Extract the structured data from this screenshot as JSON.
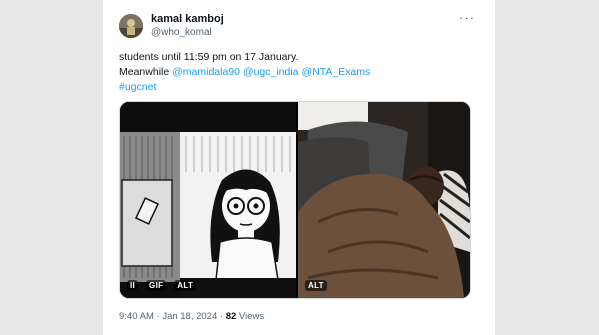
{
  "author": {
    "name": "kamal kamboj",
    "handle": "@who_komal"
  },
  "more_icon": "···",
  "tweet": {
    "line1": "students until 11:59 pm on 17 January.",
    "line2_prefix": "Meanwhile ",
    "mentions": [
      "@mamidala90",
      "@ugc_india",
      "@NTA_Exams"
    ],
    "hashtag": "#ugcnet"
  },
  "media": {
    "left": {
      "pause_icon": "II",
      "gif_label": "GIF",
      "alt_label": "ALT"
    },
    "right": {
      "alt_label": "ALT"
    }
  },
  "meta": {
    "time": "9:40 AM",
    "separator": "·",
    "date": "Jan 18, 2024",
    "views_count": "82",
    "views_label": "Views"
  },
  "colors": {
    "link": "#1d9bf0",
    "text": "#0f1419",
    "muted": "#536471"
  }
}
